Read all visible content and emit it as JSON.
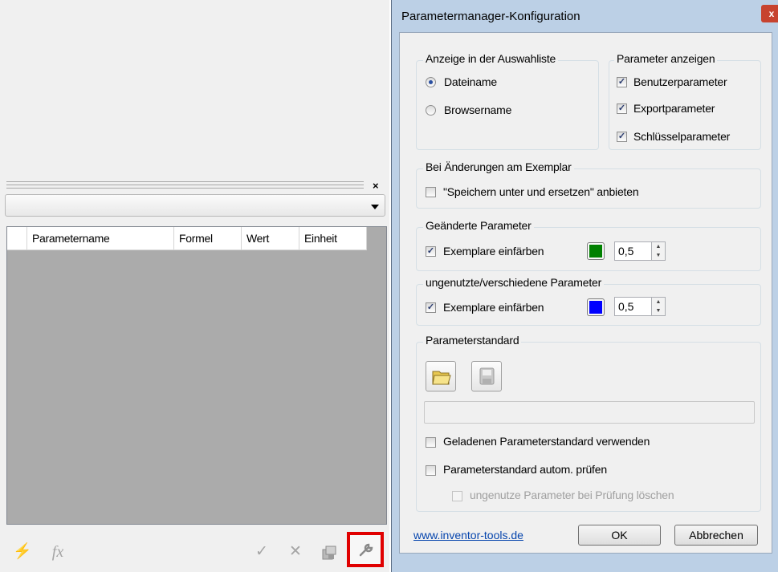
{
  "left_panel": {
    "grid_columns": [
      "Parametername",
      "Formel",
      "Wert",
      "Einheit"
    ],
    "close_glyph": "×"
  },
  "toolbar": {
    "icons": [
      "lightning-icon",
      "fx-icon",
      "check-icon",
      "cross-icon",
      "export-icon",
      "wrench-icon"
    ],
    "glyphs": {
      "lightning": "⚡",
      "fx": "fx",
      "check": "✓",
      "cross": "✕",
      "wrench": "🔧"
    },
    "highlight_color": "#e00000"
  },
  "dialog": {
    "title": "Parametermanager-Konfiguration",
    "close_glyph": "x",
    "display_group": {
      "legend": "Anzeige in der Auswahliste",
      "options": [
        {
          "label": "Dateiname",
          "selected": true
        },
        {
          "label": "Browsername",
          "selected": false
        }
      ]
    },
    "show_params_group": {
      "legend": "Parameter anzeigen",
      "items": [
        {
          "label": "Benutzerparameter",
          "checked": true
        },
        {
          "label": "Exportparameter",
          "checked": true
        },
        {
          "label": "Schlüsselparameter",
          "checked": true
        }
      ]
    },
    "instance_changes_group": {
      "legend": "Bei Änderungen am Exemplar",
      "option": {
        "label": "\"Speichern unter und ersetzen\" anbieten",
        "checked": false
      }
    },
    "changed_params_group": {
      "legend": "Geänderte Parameter",
      "option": {
        "label": "Exemplare einfärben",
        "checked": true
      },
      "color": "#008000",
      "value": "0,5"
    },
    "unused_params_group": {
      "legend": "ungenutzte/verschiedene Parameter",
      "option": {
        "label": "Exemplare einfärben",
        "checked": true
      },
      "color": "#0000ff",
      "value": "0,5"
    },
    "standard_group": {
      "legend": "Parameterstandard",
      "path": "",
      "use_loaded": {
        "label": "Geladenen Parameterstandard verwenden",
        "checked": false
      },
      "auto_check": {
        "label": "Parameterstandard autom. prüfen",
        "checked": false
      },
      "delete_unused": {
        "label": "ungenutze Parameter bei Prüfung löschen",
        "checked": false,
        "enabled": false
      }
    },
    "link": "www.inventor-tools.de",
    "ok_label": "OK",
    "cancel_label": "Abbrechen",
    "check_glyph": "✓",
    "spin_up": "▲",
    "spin_down": "▼"
  }
}
